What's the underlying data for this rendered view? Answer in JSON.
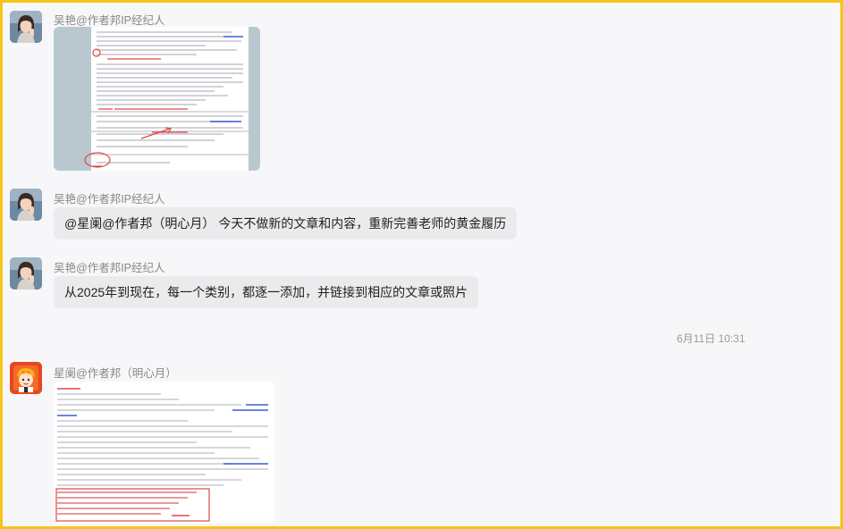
{
  "messages": [
    {
      "sender": "吴艳@作者邦IP经纪人",
      "type": "image",
      "image_name": "document-screenshot"
    },
    {
      "sender": "吴艳@作者邦IP经纪人",
      "type": "text",
      "text": "@星阑@作者邦（明心月）  今天不做新的文章和内容，重新完善老师的黄金履历"
    },
    {
      "sender": "吴艳@作者邦IP经纪人",
      "type": "text",
      "text": "从2025年到现在，每一个类别，都逐一添加，并链接到相应的文章或照片"
    },
    {
      "sender": "星阑@作者邦（明心月）",
      "type": "image",
      "image_name": "document-screenshot"
    }
  ],
  "timestamp": "6月11日 10:31",
  "colors": {
    "frame_border": "#f5c518",
    "background": "#f7f7f9",
    "bubble": "#ebebee",
    "annotation_red": "#e04848",
    "link_blue": "#3a5bd8"
  },
  "icons": [
    "woman-avatar",
    "cartoon-avatar"
  ]
}
